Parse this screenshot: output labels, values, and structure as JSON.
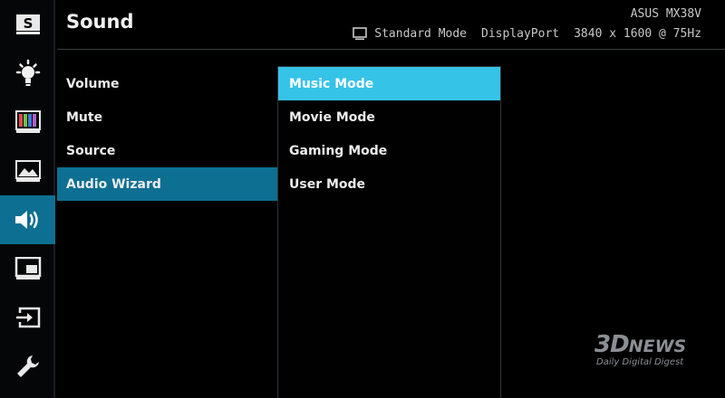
{
  "header": {
    "title": "Sound",
    "model": "ASUS MX38V",
    "mode": "Standard Mode",
    "input": "DisplayPort",
    "resolution": "3840 x 1600 @ 75Hz"
  },
  "sidebar": {
    "items": [
      {
        "name": "splendid-icon",
        "active": false
      },
      {
        "name": "brightness-icon",
        "active": false
      },
      {
        "name": "color-icon",
        "active": false
      },
      {
        "name": "image-icon",
        "active": false
      },
      {
        "name": "sound-icon",
        "active": true
      },
      {
        "name": "pip-icon",
        "active": false
      },
      {
        "name": "input-select-icon",
        "active": false
      },
      {
        "name": "system-setup-icon",
        "active": false
      }
    ],
    "splendid_letter": "S"
  },
  "menu": {
    "items": [
      {
        "label": "Volume"
      },
      {
        "label": "Mute"
      },
      {
        "label": "Source"
      },
      {
        "label": "Audio Wizard"
      }
    ],
    "active_index": 3
  },
  "submenu": {
    "items": [
      {
        "label": "Music Mode"
      },
      {
        "label": "Movie Mode"
      },
      {
        "label": "Gaming Mode"
      },
      {
        "label": "User Mode"
      }
    ],
    "selected_index": 0
  },
  "watermark": {
    "logo_main": "3D",
    "logo_news": "NEWS",
    "tagline": "Daily Digital Digest"
  },
  "colors": {
    "accent": "#0d6f92",
    "highlight": "#36c3e8"
  }
}
